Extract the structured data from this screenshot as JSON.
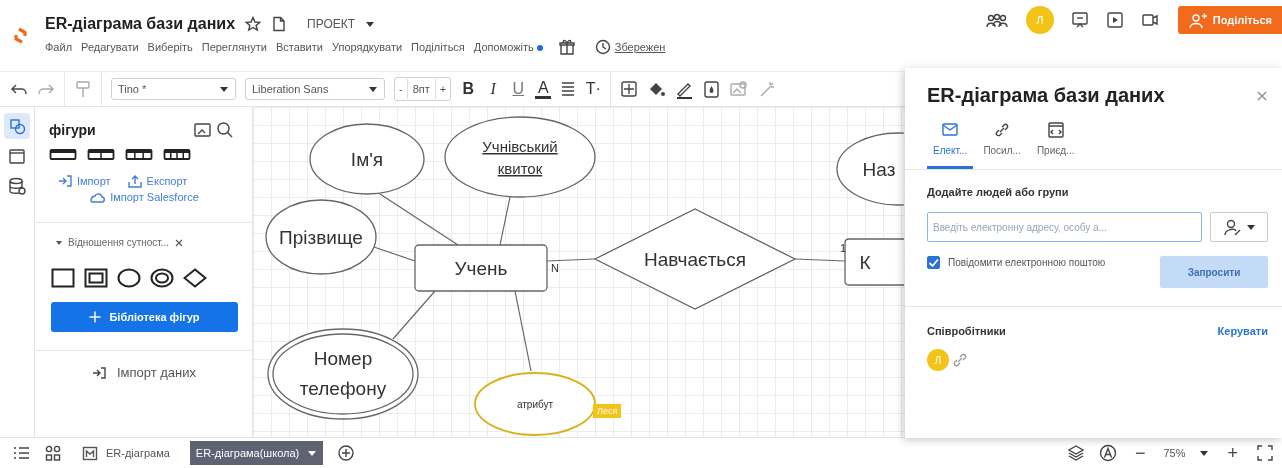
{
  "header": {
    "title": "ER-діаграма бази даних",
    "folder": "ПРОЕКТ",
    "menu": [
      {
        "label": "Файл",
        "dot": false
      },
      {
        "label": "Редагувати",
        "dot": false
      },
      {
        "label": "Виберіть",
        "dot": false
      },
      {
        "label": "Переглянути",
        "dot": false
      },
      {
        "label": "Вставити",
        "dot": false
      },
      {
        "label": "Упорядкувати",
        "dot": false
      },
      {
        "label": "Поділіться",
        "dot": false
      },
      {
        "label": "Допоможіть",
        "dot": true
      }
    ],
    "saved": "Збережен",
    "avatar": "Л",
    "share_button": "Поділіться"
  },
  "toolbar": {
    "style": "Tino *",
    "font": "Liberation Sans",
    "size": "8пт",
    "minus": "-",
    "plus": "+",
    "format": [
      "B",
      "I",
      "U",
      "A"
    ],
    "text_options": "T·"
  },
  "rail": [
    {
      "selected": true
    },
    {
      "selected": false
    },
    {
      "selected": false
    }
  ],
  "shapes_panel": {
    "title": "фігури",
    "import": "Імпорт",
    "export": "Експорт",
    "salesforce": "Імпорт Salesforce",
    "library_title": "Відношення сутност...",
    "library_button": "Бібліотека фігур",
    "import_data": "Імпорт даних"
  },
  "diagram": {
    "nodes": [
      {
        "kind": "attribute",
        "text": "Ім'я",
        "underline": false,
        "selected": false
      },
      {
        "kind": "attribute",
        "text": "Учнівський квиток",
        "underline": true,
        "selected": false
      },
      {
        "kind": "attribute",
        "text": "Наз",
        "underline": false,
        "selected": false
      },
      {
        "kind": "attribute",
        "text": "Прізвище",
        "underline": false,
        "selected": false
      },
      {
        "kind": "entity",
        "text": "Учень",
        "underline": false,
        "selected": false
      },
      {
        "kind": "relationship",
        "text": "Навчається",
        "underline": false,
        "selected": false
      },
      {
        "kind": "entity",
        "text": "К",
        "underline": false,
        "selected": false
      },
      {
        "kind": "multivalued",
        "text": "Номер телефону",
        "underline": false,
        "selected": false
      },
      {
        "kind": "attribute",
        "text": "атрибут",
        "underline": false,
        "selected": true
      }
    ],
    "labels": [
      "N",
      "1"
    ],
    "cursor": "Леся"
  },
  "share": {
    "title": "ER-діаграма бази даних",
    "tabs": [
      {
        "label": "Елект...",
        "selected": true
      },
      {
        "label": "Посил...",
        "selected": false
      },
      {
        "label": "Приєд...",
        "selected": false
      }
    ],
    "heading": "Додайте людей або групи",
    "placeholder": "Введіть електронну адресу, особу а...",
    "notify": {
      "label": "Повідомити електронною поштою",
      "checked": true
    },
    "invite": {
      "label": "Запросити",
      "disabled": true
    },
    "collaborators": "Співробітники",
    "manage": "Керувати",
    "avatar": "Л"
  },
  "footer": {
    "pages": [
      {
        "label": "ER-діаграма",
        "selected": false
      },
      {
        "label": "ER-діаграма(школа)",
        "selected": true
      }
    ],
    "zoom": "75%",
    "minus": "−",
    "plus": "+"
  }
}
